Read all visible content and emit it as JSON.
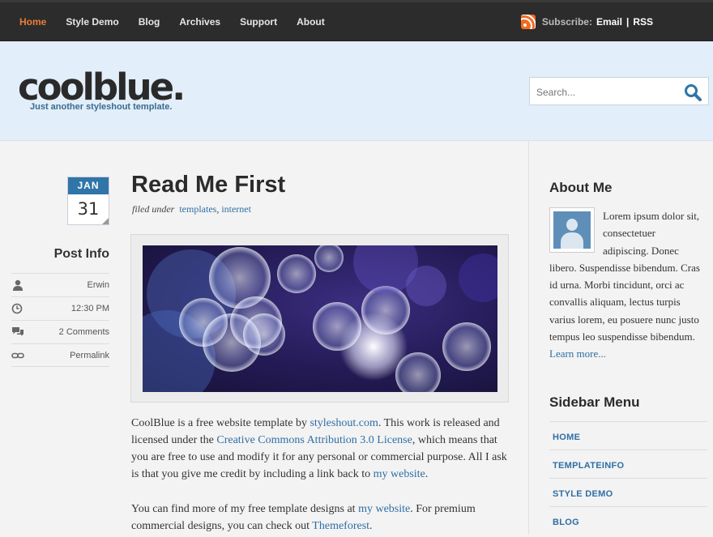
{
  "nav": {
    "items": [
      {
        "label": "Home",
        "active": true
      },
      {
        "label": "Style Demo",
        "active": false
      },
      {
        "label": "Blog",
        "active": false
      },
      {
        "label": "Archives",
        "active": false
      },
      {
        "label": "Support",
        "active": false
      },
      {
        "label": "About",
        "active": false
      }
    ],
    "subscribe_label": "Subscribe:",
    "email_label": "Email",
    "separator": "|",
    "rss_label": "RSS"
  },
  "header": {
    "logo": "coolblue.",
    "slogan": "Just another styleshout template.",
    "search_placeholder": "Search..."
  },
  "post": {
    "date_month": "JAN",
    "date_day": "31",
    "title": "Read Me First",
    "filed_under": "filed under",
    "tags": [
      "templates",
      "internet"
    ],
    "tag_separator": ",",
    "info_title": "Post Info",
    "info": [
      {
        "icon": "user-icon",
        "text": "Erwin"
      },
      {
        "icon": "clock-icon",
        "text": "12:30 PM"
      },
      {
        "icon": "comments-icon",
        "text": "2 Comments"
      },
      {
        "icon": "link-icon",
        "text": "Permalink"
      }
    ],
    "p1": {
      "t1": "CoolBlue is a free website template by ",
      "link1": "styleshout.com",
      "t2": ". This work is released and licensed under the ",
      "link2": "Creative Commons Attribution 3.0 License",
      "t3": ", which means that you are free to use and modify it for any personal or commercial purpose. All I ask is that you give me credit by including a link back to ",
      "link3": "my website",
      "t4": "."
    },
    "p2": {
      "t1": "You can find more of my free template designs at ",
      "link1": "my website",
      "t2": ". For premium commercial designs, you can check out ",
      "link2": "Themeforest",
      "t3": "."
    }
  },
  "sidebar": {
    "about_title": "About Me",
    "about_text": "Lorem ipsum dolor sit, consectetuer adipiscing. Donec libero. Suspendisse bibendum. Cras id urna. Morbi tincidunt, orci ac convallis aliquam, lectus turpis varius lorem, eu posuere nunc justo tempus leo suspendisse bibendum. ",
    "about_link": "Learn more...",
    "menu_title": "Sidebar Menu",
    "menu": [
      "HOME",
      "TEMPLATEINFO",
      "STYLE DEMO",
      "BLOG"
    ]
  },
  "colors": {
    "nav_bg": "#2c2c2c",
    "nav_active": "#ec7d37",
    "header_bg": "#e2eef9",
    "link": "#2f6ea5",
    "date_month_bg": "#2f75a8"
  }
}
